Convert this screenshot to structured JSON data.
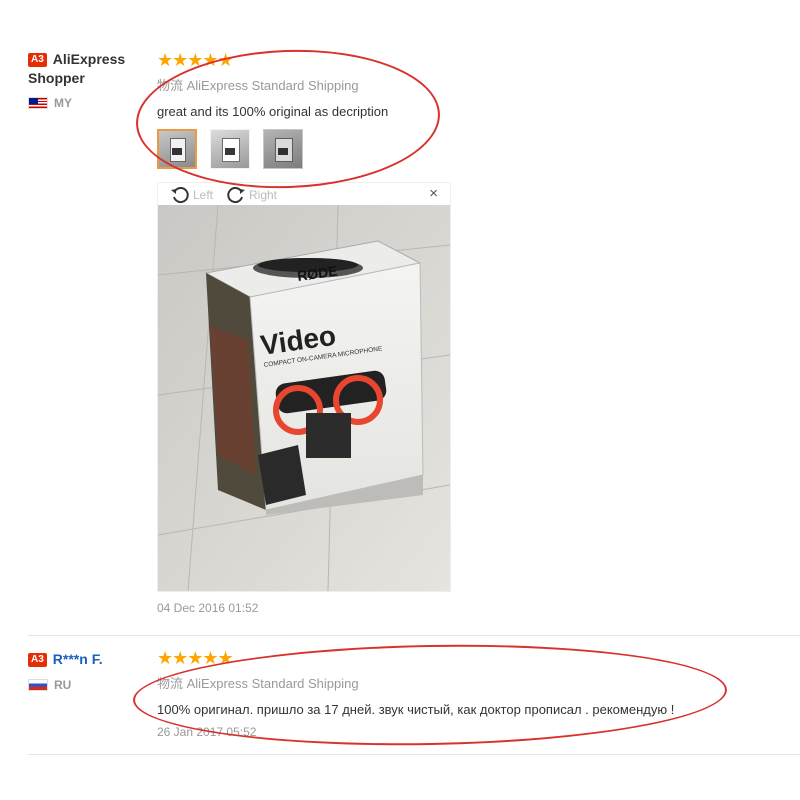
{
  "reviews": [
    {
      "level": "A3",
      "user": "AliExpress Shopper",
      "country": "MY",
      "stars": "★★★★★",
      "shipping": "物流 AliExpress Standard Shipping",
      "text": "great and its 100% original as decription",
      "viewer": {
        "left": "Left",
        "right": "Right",
        "close": "×"
      },
      "date": "04 Dec 2016 01:52"
    },
    {
      "level": "A3",
      "user": "R***n F.",
      "country": "RU",
      "stars": "★★★★★",
      "shipping": "物流 AliExpress Standard Shipping",
      "text": "100% оригинал. пришло за 17 дней. звук чистый, как доктор прописал . рекомендую !",
      "date": "26 Jan 2017 05:52"
    }
  ],
  "product_box": {
    "brand": "RØDE",
    "title": "Video",
    "subtitle": "COMPACT ON-CAMERA MICROPHONE"
  },
  "colors": {
    "level_badge": "#e62e04",
    "stars": "#ffa500",
    "annotation": "#d8322c"
  },
  "icons": [
    "rotate-left-icon",
    "rotate-right-icon",
    "close-icon"
  ]
}
